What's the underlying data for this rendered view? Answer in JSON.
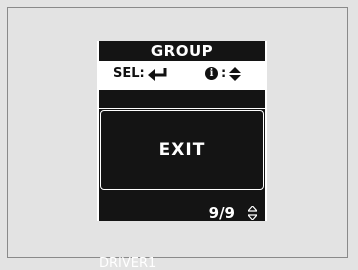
{
  "header": {
    "title": "GROUP"
  },
  "controls": {
    "sel_label": "SEL:",
    "info_label": "i",
    "info_colon": ":"
  },
  "icons": [
    "return-arrow-icon",
    "info-icon",
    "up-down-icon"
  ],
  "menu": {
    "selected_item": "EXIT"
  },
  "pager": {
    "current": 9,
    "total": 9,
    "text": "9/9"
  },
  "footer": {
    "profile": "DRIVER1"
  },
  "colors": {
    "background": "#e3e3e3",
    "panel": "#141414",
    "text_light": "#ffffff",
    "text_dark": "#111111"
  }
}
